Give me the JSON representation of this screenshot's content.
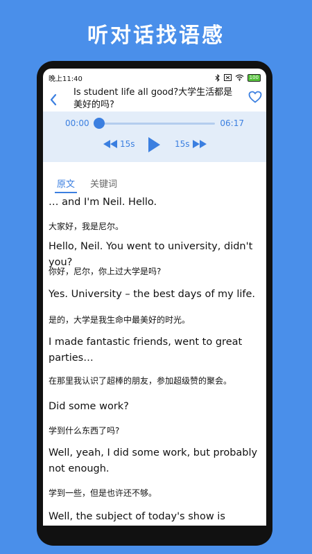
{
  "promo_title": "听对话找语感",
  "status": {
    "time": "晚上11:40",
    "battery": "100"
  },
  "header": {
    "title": "Is student life all good?大学生活都是美好的吗?"
  },
  "player": {
    "current_time": "00:00",
    "total_time": "06:17",
    "progress": 0,
    "rewind_label": "15s",
    "forward_label": "15s"
  },
  "tabs": {
    "transcript": "原文",
    "keywords": "关键词"
  },
  "transcript": [
    {
      "lang": "en",
      "text": "… and I'm Neil. Hello."
    },
    {
      "lang": "zh",
      "text": "大家好，我是尼尔。"
    },
    {
      "lang": "en",
      "text": "Hello, Neil. You went to university, didn't you?"
    },
    {
      "lang": "zh",
      "text": "你好，尼尔，你上过大学是吗?"
    },
    {
      "lang": "en",
      "text": "Yes. University – the best days of my life."
    },
    {
      "lang": "zh",
      "text": "是的，大学是我生命中最美好的时光。"
    },
    {
      "lang": "en",
      "text": "I made fantastic friends, went to great parties…"
    },
    {
      "lang": "zh",
      "text": "在那里我认识了超棒的朋友，参加超级赞的聚会。"
    },
    {
      "lang": "en",
      "text": "Did some work?"
    },
    {
      "lang": "zh",
      "text": "学到什么东西了吗?"
    },
    {
      "lang": "en",
      "text": "Well, yeah, I did some work, but probably not enough."
    },
    {
      "lang": "zh",
      "text": "学到一些，但是也许还不够。"
    },
    {
      "lang": "en",
      "text": "Well, the subject of today's show is student"
    }
  ],
  "colors": {
    "accent": "#3B7FE0",
    "background": "#4A8FEA",
    "player_bg": "#E3EDF9"
  }
}
